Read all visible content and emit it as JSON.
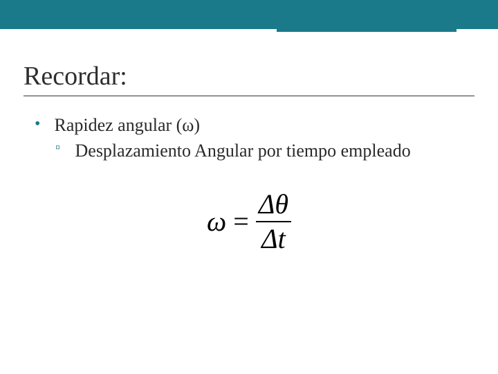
{
  "colors": {
    "accent": "#1b7a8a",
    "text": "#2a2a2a"
  },
  "title": "Recordar:",
  "bullets": {
    "item1": "Rapidez angular (ω)",
    "sub1": "Desplazamiento Angular por tiempo empleado"
  },
  "formula": {
    "lhs": "ω",
    "equals": "=",
    "numerator": "Δθ",
    "denominator": "Δt"
  }
}
